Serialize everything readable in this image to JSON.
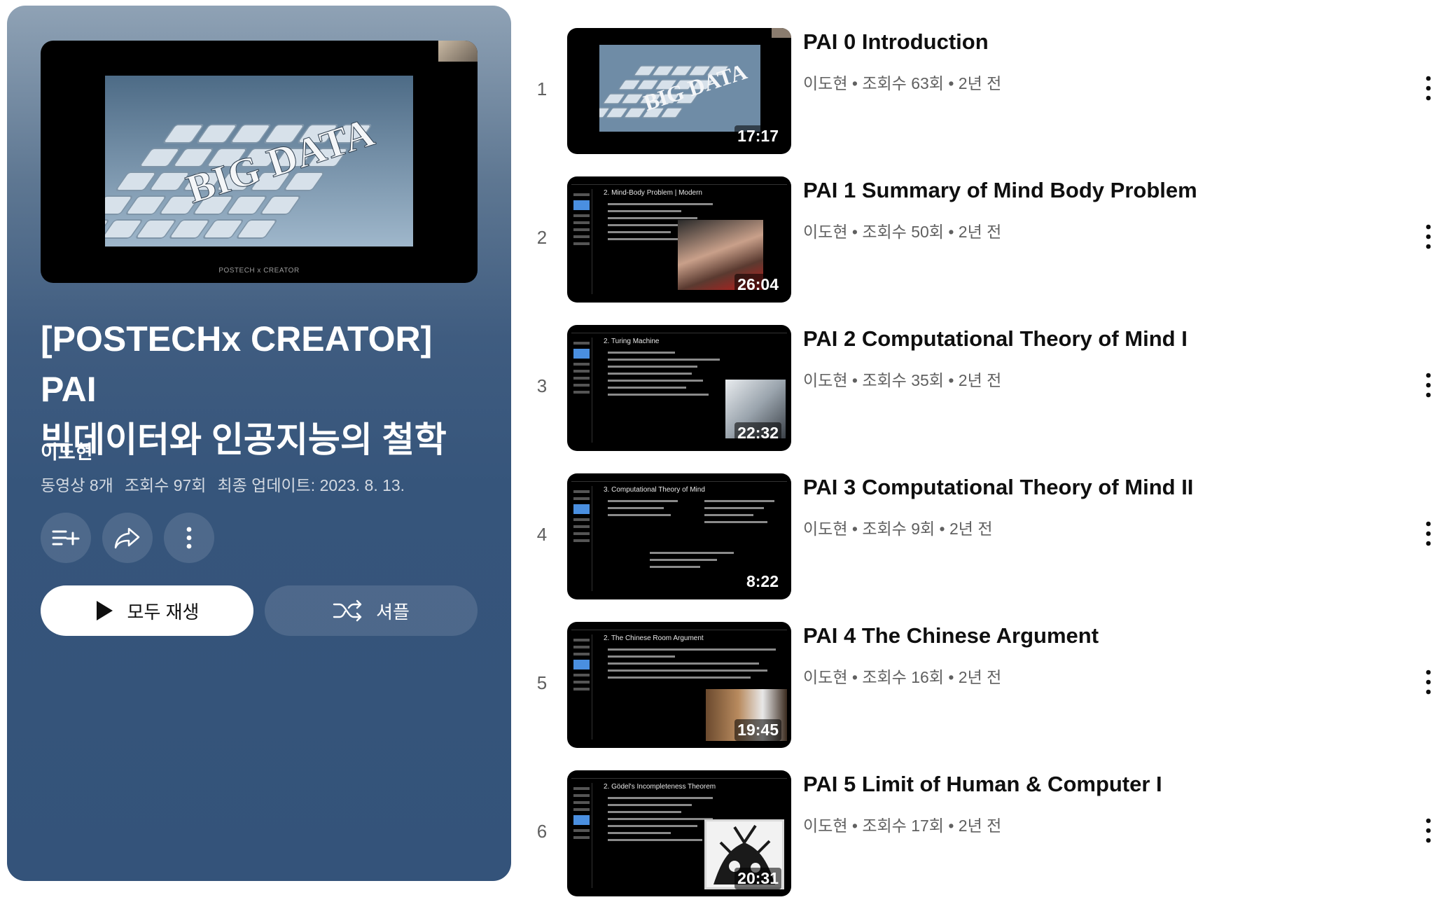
{
  "playlist": {
    "hero_thumbnail": {
      "slide_text": "BIG DATA",
      "footer": "POSTECH x CREATOR"
    },
    "title_line1": "[POSTECHx CREATOR] PAI",
    "title_line2": "빅데이터와 인공지능의 철학",
    "owner": "이도현",
    "video_count": "동영상 8개",
    "view_count": "조회수 97회",
    "last_updated": "최종 업데이트: 2023. 8. 13.",
    "actions": {
      "save_icon": "playlist-add-icon",
      "share_icon": "share-icon",
      "more_icon": "more-vert-icon"
    },
    "play_all_label": "모두 재생",
    "shuffle_label": "셔플"
  },
  "videos": [
    {
      "index": "1",
      "title": "PAI 0 Introduction",
      "channel": "이도현",
      "views": "조회수 63회",
      "age": "2년 전",
      "duration": "17:17",
      "slide_heading": "BIG DATA"
    },
    {
      "index": "2",
      "title": "PAI 1 Summary of Mind Body Problem",
      "channel": "이도현",
      "views": "조회수 50회",
      "age": "2년 전",
      "duration": "26:04",
      "slide_heading": "2. Mind-Body Problem | Modern"
    },
    {
      "index": "3",
      "title": "PAI 2 Computational Theory of Mind I",
      "channel": "이도현",
      "views": "조회수 35회",
      "age": "2년 전",
      "duration": "22:32",
      "slide_heading": "2. Turing Machine"
    },
    {
      "index": "4",
      "title": "PAI 3 Computational Theory of Mind II",
      "channel": "이도현",
      "views": "조회수 9회",
      "age": "2년 전",
      "duration": "8:22",
      "slide_heading": "3. Computational Theory of Mind"
    },
    {
      "index": "5",
      "title": "PAI 4 The Chinese Argument",
      "channel": "이도현",
      "views": "조회수 16회",
      "age": "2년 전",
      "duration": "19:45",
      "slide_heading": "2. The Chinese Room Argument"
    },
    {
      "index": "6",
      "title": "PAI 5 Limit of Human & Computer I",
      "channel": "이도현",
      "views": "조회수 17회",
      "age": "2년 전",
      "duration": "20:31",
      "slide_heading": "2. Gödel's Incompleteness Theorem"
    }
  ],
  "separator": "•",
  "colors": {
    "panel_top": "#8fa2b5",
    "panel_bottom": "#34537a",
    "title_text": "#0f0f0f",
    "meta_text": "#606060",
    "slide_highlight": "#4a8fe0"
  }
}
